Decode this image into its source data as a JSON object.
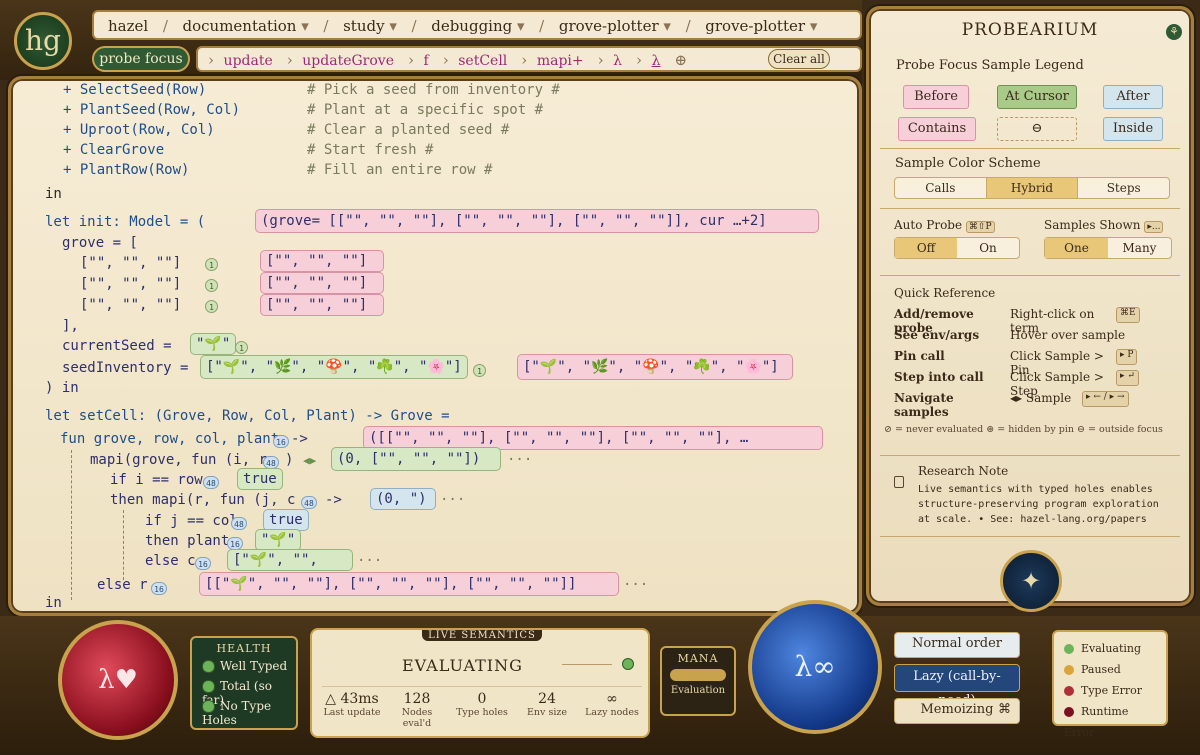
{
  "logo": "hg",
  "breadcrumbs": [
    "hazel",
    "documentation",
    "study",
    "debugging",
    "grove-plotter",
    "grove-plotter"
  ],
  "probe_focus": "probe focus",
  "probe_path": [
    "update",
    "updateGrove",
    "f",
    "setCell",
    "mapi+",
    "λ",
    "λ"
  ],
  "clear_all": "Clear all",
  "code": {
    "l1_cmd": "+ SelectSeed(Row)",
    "l1_cmt": "# Pick a seed from inventory #",
    "l2_cmd": "+ PlantSeed(Row, Col)",
    "l2_cmt": "# Plant at a specific spot #",
    "l3_cmd": "+ Uproot(Row, Col)",
    "l3_cmt": "# Clear a planted seed #",
    "l4_cmd": "+ ClearGrove",
    "l4_cmt": "# Start fresh #",
    "l5_cmd": "+ PlantRow(Row)",
    "l5_cmt": "# Fill an entire row #",
    "in1": "in",
    "init_head": "let init: Model = (",
    "init_probe": "(grove= [[\"\", \"\", \"\"], [\"\", \"\", \"\"], [\"\", \"\", \"\"]], cur …+2]",
    "grove_eq": "grove = [",
    "row": "[\"\", \"\", \"\"]",
    "row_probe": "[\"\", \"\", \"\"]",
    "close_bracket": "],",
    "current_seed": "currentSeed =",
    "current_seed_val": "\"🌱\"",
    "seed_inventory": "seedInventory =",
    "seed_inventory_val": "[\"🌱\", \"🌿\", \"🍄\", \"☘️\", \"🌸\"]",
    "seed_inventory_probe": "[\"🌱\", \"🌿\", \"🍄\", \"☘️\", \"🌸\"]",
    "close_in": ") in",
    "setcell_head": "let setCell: (Grove, Row, Col, Plant) -> Grove =",
    "fun_line": "fun grove, row, col, plant",
    "fun_probe": "([[\"\", \"\", \"\"], [\"\", \"\", \"\"], [\"\", \"\", \"\"], …",
    "mapi_line": "mapi(grove, fun (i, r",
    "mapi_probe": "(0, [\"\", \"\", \"\"])",
    "if_i": "if i == row",
    "true1": "true",
    "then_mapi": "then mapi(r, fun (j, c",
    "then_mapi_probe": "(0, \")",
    "if_j": "if j == col",
    "true2": "true",
    "then_plant": "then plant",
    "plant_val": "\"🌱\"",
    "else_c": "else c",
    "else_c_val": "[\"🌱\", \"\", \"\"]",
    "else_r": "else r",
    "else_r_val": "[[\"🌱\", \"\", \"\"], [\"\", \"\", \"\"], [\"\", \"\", \"\"]]",
    "in2": "in",
    "arrow": "->",
    "counts": {
      "one": "1",
      "n16": "16",
      "n48": "48"
    },
    "ellipsis": "···"
  },
  "right_panel": {
    "title": "PROBEARIUM",
    "legend_title": "Probe Focus Sample Legend",
    "legend": {
      "before": "Before",
      "at_cursor": "At Cursor",
      "after": "After",
      "contains": "Contains",
      "none": "⊖",
      "inside": "Inside"
    },
    "scheme_title": "Sample Color Scheme",
    "scheme": [
      "Calls",
      "Hybrid",
      "Steps"
    ],
    "auto_probe": "Auto Probe",
    "auto_probe_key": "⌘⇧P",
    "auto_opts": [
      "Off",
      "On"
    ],
    "samples_shown": "Samples Shown",
    "samples_key": "▸...",
    "samples_opts": [
      "One",
      "Many"
    ],
    "qr_title": "Quick Reference",
    "qr": [
      {
        "k": "Add/remove probe",
        "v": "Right-click on term",
        "key": "⌘E"
      },
      {
        "k": "See env/args",
        "v": "Hover over sample",
        "key": ""
      },
      {
        "k": "Pin call",
        "v": "Click Sample > Pin",
        "key": "▸ P"
      },
      {
        "k": "Step into call",
        "v": "Click Sample > Step",
        "key": "▸ ↵"
      },
      {
        "k": "Navigate samples",
        "v": "◂▸ Sample",
        "key": "▸ ← / ▸ →"
      }
    ],
    "qr_foot": "⊘ = never evaluated   ⊛ = hidden by pin   ⊖ = outside focus",
    "note_title": "Research Note",
    "note_body": "Live semantics with typed holes enables structure-preserving program exploration at scale. • See: hazel-lang.org/papers"
  },
  "bottom": {
    "health_title": "HEALTH",
    "health": [
      "Well Typed",
      "Total (so far)",
      "No Type Holes"
    ],
    "live_title": "LIVE SEMANTICS",
    "status": "EVALUATING",
    "stats": [
      {
        "v": "△ 43ms",
        "l": "Last update"
      },
      {
        "v": "128",
        "l": "Nodes eval'd"
      },
      {
        "v": "0",
        "l": "Type holes"
      },
      {
        "v": "24",
        "l": "Env size"
      },
      {
        "v": "∞",
        "l": "Lazy nodes"
      }
    ],
    "mana_title": "MANA",
    "mana_label": "Evaluation",
    "eval_modes": [
      "Normal order",
      "Lazy (call-by-need)",
      "Memoizing"
    ],
    "memo_icon": "⌘",
    "status_legend": [
      "Evaluating",
      "Paused",
      "Type Error",
      "Runtime Error"
    ],
    "red_orb": "λ♥",
    "blue_orb": "λ∞"
  },
  "colors": {
    "pink": "#f6cfd8",
    "green": "#d6e8c4",
    "blue": "#d5e5ee",
    "gold": "#e8c878"
  }
}
